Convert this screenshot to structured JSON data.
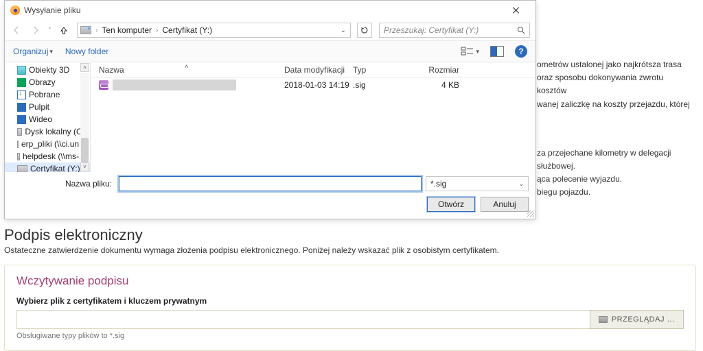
{
  "dialog": {
    "title": "Wysyłanie pliku",
    "breadcrumb": {
      "root": "Ten komputer",
      "folder": "Certyfikat (Y:)"
    },
    "search_placeholder": "Przeszukaj: Certyfikat (Y:)",
    "toolbar": {
      "organize": "Organizuj",
      "newfolder": "Nowy folder"
    },
    "tree": [
      {
        "label": "Obiekty 3D",
        "icon": "obj3d"
      },
      {
        "label": "Obrazy",
        "icon": "square"
      },
      {
        "label": "Pobrane",
        "icon": "down"
      },
      {
        "label": "Pulpit",
        "icon": "square"
      },
      {
        "label": "Wideo",
        "icon": "square"
      },
      {
        "label": "Dysk lokalny (C:)",
        "icon": "drive"
      },
      {
        "label": "erp_pliki (\\\\ci.un…",
        "icon": "drive"
      },
      {
        "label": "helpdesk (\\\\ms-…",
        "icon": "drive"
      },
      {
        "label": "Certyfikat (Y:)",
        "icon": "drive",
        "selected": true
      }
    ],
    "columns": {
      "name": "Nazwa",
      "date": "Data modyfikacji",
      "type": "Typ",
      "size": "Rozmiar"
    },
    "rows": [
      {
        "date": "2018-01-03 14:19",
        "type": ".sig",
        "size": "4 KB"
      }
    ],
    "filename_label": "Nazwa pliku:",
    "filter": "*.sig",
    "open": "Otwórz",
    "cancel": "Anuluj"
  },
  "bg": {
    "l1": "ometrów ustalonej jako najkrótsza trasa",
    "l2": "oraz sposobu dokonywania zwrotu kosztów",
    "l3": "wanej zaliczkę na koszty przejazdu, której",
    "l4": "za przejechane kilometry w delegacji służbowej.",
    "l5": "ąca polecenie wyjazdu.",
    "l6": "biegu pojazdu."
  },
  "page": {
    "heading": "Podpis elektroniczny",
    "sub": "Ostateczne zatwierdzenie dokumentu wymaga złożenia podpisu elektronicznego. Poniżej należy wskazać plik z osobistym certyfikatem.",
    "panel_title": "Wczytywanie podpisu",
    "panel_label": "Wybierz plik z certyfikatem i kluczem prywatnym",
    "browse": "PRZEGLĄDAJ …",
    "hint": "Obsługiwane typy plików to *.sig"
  }
}
